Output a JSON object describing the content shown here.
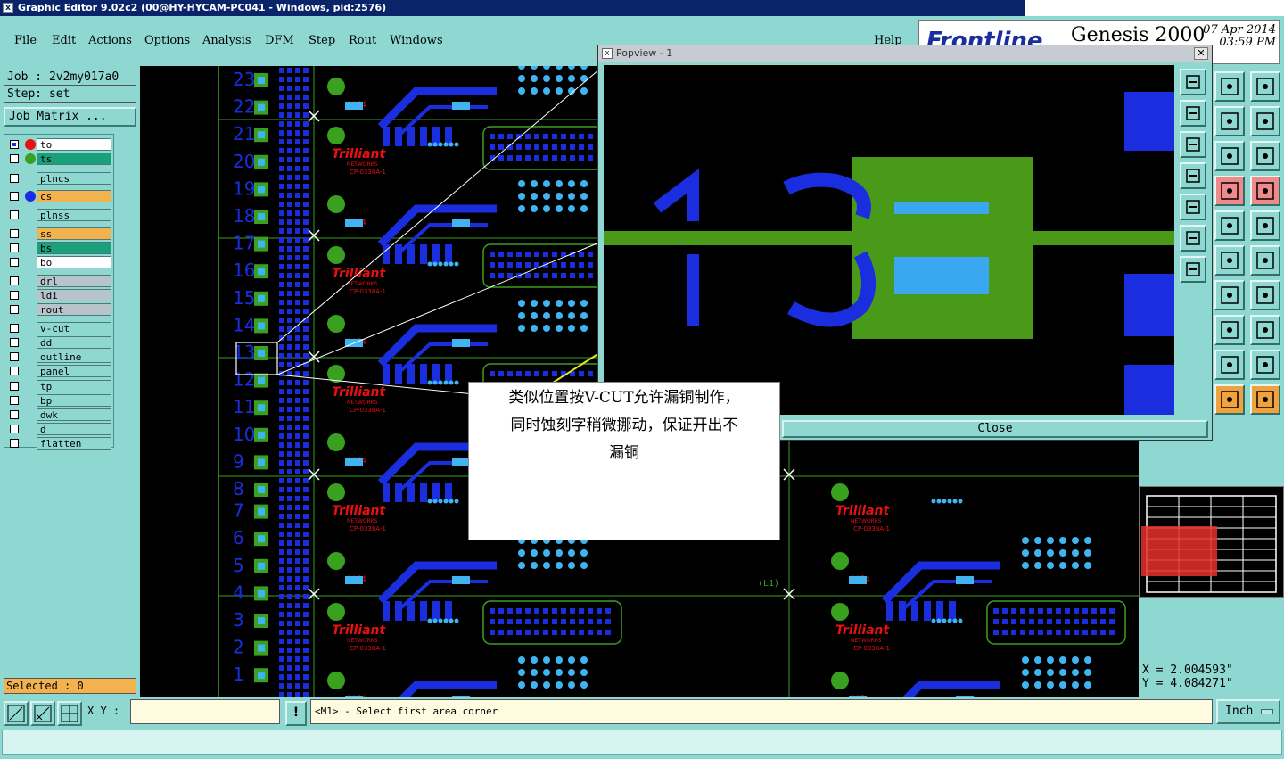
{
  "window": {
    "title": "Graphic Editor 9.02c2 (00@HY-HYCAM-PC041 - Windows, pid:2576)"
  },
  "menu": {
    "items": [
      "File",
      "Edit",
      "Actions",
      "Options",
      "Analysis",
      "DFM",
      "Step",
      "Rout",
      "Windows"
    ],
    "help": "Help"
  },
  "brand": {
    "logo": "Frontline",
    "product": "Genesis 2000",
    "date": "07 Apr 2014",
    "time": "03:59 PM"
  },
  "job": {
    "job_label": "Job : 2v2my017a0",
    "step_label": "Step: set",
    "matrix_button": "Job Matrix ..."
  },
  "layers": [
    {
      "name": "to",
      "color": "#ffffff",
      "dot": "#e81010",
      "checked": true
    },
    {
      "name": "ts",
      "color": "#1aa07a",
      "dot": "#3aa020",
      "checked": false
    },
    {
      "name": "plncs",
      "color": "#8fd8d2",
      "dot": "",
      "checked": false
    },
    {
      "name": "cs",
      "color": "#f2b24e",
      "dot": "#1a2ee0",
      "checked": false
    },
    {
      "name": "plnss",
      "color": "#8fd8d2",
      "dot": "",
      "checked": false
    },
    {
      "name": "ss",
      "color": "#f2b24e",
      "dot": "",
      "checked": false
    },
    {
      "name": "bs",
      "color": "#1aa07a",
      "dot": "",
      "checked": false
    },
    {
      "name": "bo",
      "color": "#ffffff",
      "dot": "",
      "checked": false
    },
    {
      "name": "drl",
      "color": "#b8c4cc",
      "dot": "",
      "checked": false
    },
    {
      "name": "ldi",
      "color": "#b8c4cc",
      "dot": "",
      "checked": false
    },
    {
      "name": "rout",
      "color": "#b8c4cc",
      "dot": "",
      "checked": false
    },
    {
      "name": "v-cut",
      "color": "#8fd8d2",
      "dot": "",
      "checked": false
    },
    {
      "name": "dd",
      "color": "#8fd8d2",
      "dot": "",
      "checked": false
    },
    {
      "name": "outline",
      "color": "#8fd8d2",
      "dot": "",
      "checked": false
    },
    {
      "name": "panel",
      "color": "#8fd8d2",
      "dot": "",
      "checked": false
    },
    {
      "name": "tp",
      "color": "#8fd8d2",
      "dot": "",
      "checked": false
    },
    {
      "name": "bp",
      "color": "#8fd8d2",
      "dot": "",
      "checked": false
    },
    {
      "name": "dwk",
      "color": "#8fd8d2",
      "dot": "",
      "checked": false
    },
    {
      "name": "d",
      "color": "#8fd8d2",
      "dot": "",
      "checked": false
    },
    {
      "name": "flatten",
      "color": "#8fd8d2",
      "dot": "",
      "checked": false
    }
  ],
  "selected": "Selected : 0",
  "board": {
    "row_numbers": [
      "23",
      "22",
      "21",
      "20",
      "19",
      "18",
      "17",
      "16",
      "15",
      "14",
      "13",
      "12",
      "11",
      "10",
      "9",
      "8",
      "7",
      "6",
      "5",
      "4",
      "3",
      "2",
      "1"
    ],
    "silk_brand": "Trilliant",
    "silk_sub": "NETWORKS",
    "silk_part": "CP-0338A-1",
    "silk_code": "1054",
    "silk_label": "(L1)"
  },
  "popview": {
    "title": "Popview - 1",
    "close_label": "Close",
    "zoom_digits": "13"
  },
  "annotation": {
    "text": "类似位置按V-CUT允许漏铜制作，\n同时蚀刻字稍微挪动，保证开出不\n漏铜"
  },
  "coords": {
    "x": "X  = 2.004593\"",
    "y": "Y  = 4.084271\""
  },
  "status": {
    "xy_label": "X Y :",
    "xy_value": "",
    "alert": "!",
    "prompt": "<M1> - Select first area corner",
    "unit": "Inch"
  },
  "colors": {
    "panel_bg": "#8fd8d2",
    "copper": "#1a2ee0",
    "pad_cyan": "#40b4f0",
    "pad_green": "#3aa020",
    "silk_red": "#e81010"
  }
}
